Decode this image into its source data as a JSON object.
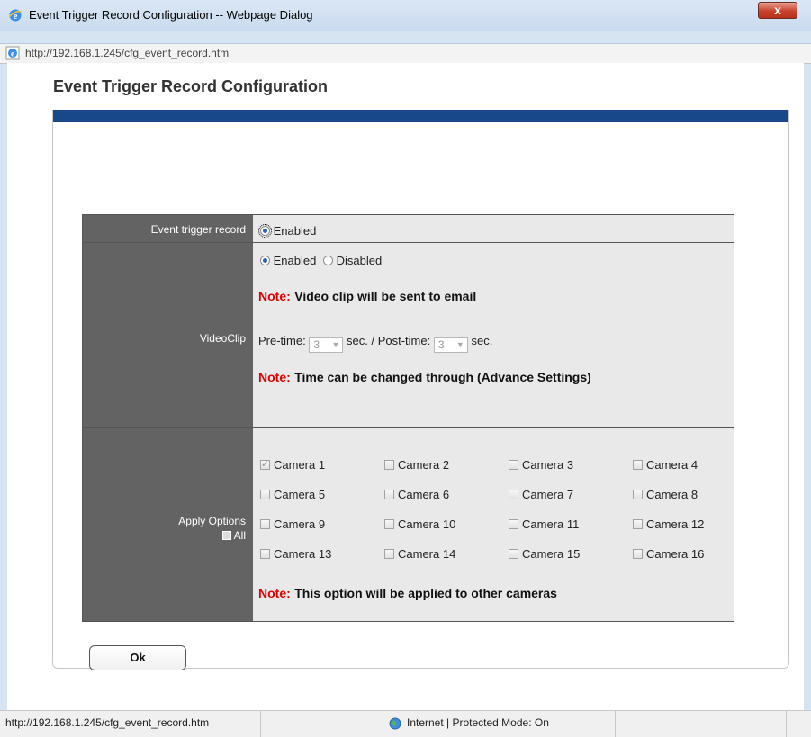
{
  "window": {
    "title": "Event Trigger Record Configuration -- Webpage Dialog",
    "close_label": "x"
  },
  "address": {
    "url": "http://192.168.1.245/cfg_event_record.htm"
  },
  "page": {
    "title": "Event Trigger Record Configuration"
  },
  "event_trigger": {
    "label": "Event trigger record",
    "option": "Enabled",
    "checked": true
  },
  "videoclip": {
    "label": "VideoClip",
    "enabled_label": "Enabled",
    "disabled_label": "Disabled",
    "selected": "Enabled",
    "note1_prefix": "Note:",
    "note1_text": "Video clip will be sent to email",
    "pre_label": "Pre-time:",
    "pre_value": "3",
    "sec1": "sec.",
    "slash": "/",
    "post_label": "Post-time:",
    "post_value": "3",
    "sec2": "sec.",
    "note2_prefix": "Note:",
    "note2_text": "Time can be changed through (Advance Settings)"
  },
  "apply": {
    "label": "Apply Options",
    "all_label": "All",
    "cameras": [
      {
        "label": "Camera 1",
        "checked": true
      },
      {
        "label": "Camera 2",
        "checked": false
      },
      {
        "label": "Camera 3",
        "checked": false
      },
      {
        "label": "Camera 4",
        "checked": false
      },
      {
        "label": "Camera 5",
        "checked": false
      },
      {
        "label": "Camera 6",
        "checked": false
      },
      {
        "label": "Camera 7",
        "checked": false
      },
      {
        "label": "Camera 8",
        "checked": false
      },
      {
        "label": "Camera 9",
        "checked": false
      },
      {
        "label": "Camera 10",
        "checked": false
      },
      {
        "label": "Camera 11",
        "checked": false
      },
      {
        "label": "Camera 12",
        "checked": false
      },
      {
        "label": "Camera 13",
        "checked": false
      },
      {
        "label": "Camera 14",
        "checked": false
      },
      {
        "label": "Camera 15",
        "checked": false
      },
      {
        "label": "Camera 16",
        "checked": false
      }
    ],
    "note_prefix": "Note:",
    "note_text": "This option will be applied to other cameras"
  },
  "buttons": {
    "ok": "Ok"
  },
  "status": {
    "url": "http://192.168.1.245/cfg_event_record.htm",
    "zone": "Internet | Protected Mode: On"
  },
  "colors": {
    "header_bar": "#18478a",
    "label_column": "#636363",
    "note_red": "#e00000"
  }
}
